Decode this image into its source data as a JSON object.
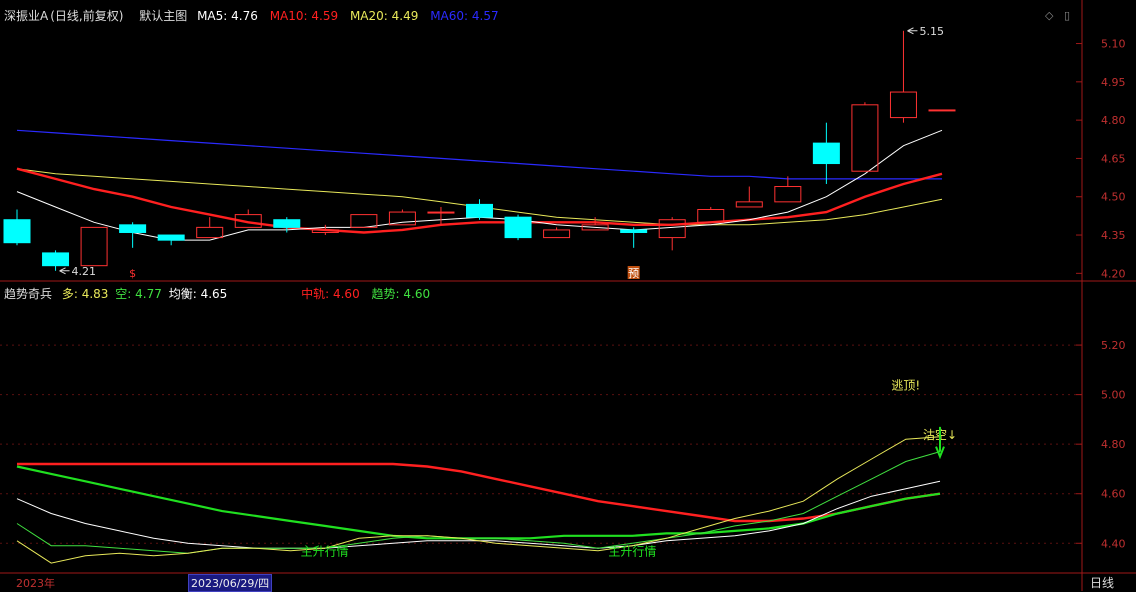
{
  "header": {
    "stock_name": "深振业A",
    "stock_mode": "(日线,前复权)",
    "template": "默认主图",
    "ma5_label": "MA5:",
    "ma5_value": "4.76",
    "ma10_label": "MA10:",
    "ma10_value": "4.59",
    "ma20_label": "MA20:",
    "ma20_value": "4.49",
    "ma60_label": "MA60:",
    "ma60_value": "4.57"
  },
  "sub_header": {
    "indicator": "趋势奇兵",
    "long_label": "多:",
    "long_value": "4.83",
    "short_label": "空:",
    "short_value": "4.77",
    "balance_label": "均衡:",
    "balance_value": "4.65",
    "mid_label": "中轨:",
    "mid_value": "4.60",
    "trend_label": "趋势:",
    "trend_value": "4.60"
  },
  "footer": {
    "year": "2023年",
    "cursor_date": "2023/06/29/四",
    "period": "日线"
  },
  "colors": {
    "up": "#ff3232",
    "down": "#00ffff",
    "ma5": "#ffffff",
    "ma10": "#ff2020",
    "ma20": "#e8e85a",
    "ma60": "#2a2aff",
    "green": "#20e020",
    "axis": "#a01818",
    "grid": "#5a1010"
  },
  "chart_data": [
    {
      "type": "candlestick",
      "name": "main",
      "ylim": [
        4.17,
        5.2
      ],
      "y_ticks": [
        "5.10",
        "4.95",
        "4.80",
        "4.65",
        "4.50",
        "4.35",
        "4.20"
      ],
      "candles": [
        {
          "open": 4.41,
          "high": 4.45,
          "low": 4.31,
          "close": 4.32
        },
        {
          "open": 4.28,
          "high": 4.29,
          "low": 4.21,
          "close": 4.23
        },
        {
          "open": 4.23,
          "high": 4.38,
          "low": 4.23,
          "close": 4.38
        },
        {
          "open": 4.39,
          "high": 4.4,
          "low": 4.3,
          "close": 4.36
        },
        {
          "open": 4.35,
          "high": 4.35,
          "low": 4.31,
          "close": 4.33
        },
        {
          "open": 4.34,
          "high": 4.42,
          "low": 4.34,
          "close": 4.38
        },
        {
          "open": 4.38,
          "high": 4.45,
          "low": 4.38,
          "close": 4.43
        },
        {
          "open": 4.41,
          "high": 4.42,
          "low": 4.36,
          "close": 4.38
        },
        {
          "open": 4.36,
          "high": 4.39,
          "low": 4.35,
          "close": 4.37
        },
        {
          "open": 4.38,
          "high": 4.43,
          "low": 4.38,
          "close": 4.43
        },
        {
          "open": 4.39,
          "high": 4.45,
          "low": 4.39,
          "close": 4.44
        },
        {
          "open": 4.44,
          "high": 4.46,
          "low": 4.39,
          "close": 4.44
        },
        {
          "open": 4.47,
          "high": 4.49,
          "low": 4.41,
          "close": 4.42
        },
        {
          "open": 4.42,
          "high": 4.43,
          "low": 4.33,
          "close": 4.34
        },
        {
          "open": 4.34,
          "high": 4.38,
          "low": 4.34,
          "close": 4.37
        },
        {
          "open": 4.37,
          "high": 4.42,
          "low": 4.37,
          "close": 4.39
        },
        {
          "open": 4.37,
          "high": 4.38,
          "low": 4.3,
          "close": 4.36
        },
        {
          "open": 4.34,
          "high": 4.42,
          "low": 4.29,
          "close": 4.41
        },
        {
          "open": 4.4,
          "high": 4.46,
          "low": 4.4,
          "close": 4.45
        },
        {
          "open": 4.46,
          "high": 4.54,
          "low": 4.46,
          "close": 4.48
        },
        {
          "open": 4.48,
          "high": 4.58,
          "low": 4.48,
          "close": 4.54
        },
        {
          "open": 4.71,
          "high": 4.79,
          "low": 4.55,
          "close": 4.63
        },
        {
          "open": 4.6,
          "high": 4.87,
          "low": 4.6,
          "close": 4.86
        },
        {
          "open": 4.81,
          "high": 5.15,
          "low": 4.79,
          "close": 4.91
        },
        {
          "open": 4.84,
          "high": 4.84,
          "low": 4.84,
          "close": 4.84
        }
      ],
      "ma5": [
        4.52,
        4.46,
        4.4,
        4.36,
        4.33,
        4.33,
        4.37,
        4.37,
        4.38,
        4.38,
        4.4,
        4.41,
        4.42,
        4.41,
        4.39,
        4.38,
        4.37,
        4.38,
        4.39,
        4.41,
        4.44,
        4.5,
        4.59,
        4.7,
        4.76
      ],
      "ma10": [
        4.61,
        4.57,
        4.53,
        4.5,
        4.46,
        4.43,
        4.4,
        4.38,
        4.37,
        4.36,
        4.37,
        4.39,
        4.4,
        4.4,
        4.4,
        4.4,
        4.39,
        4.39,
        4.4,
        4.41,
        4.42,
        4.44,
        4.5,
        4.55,
        4.59
      ],
      "ma20": [
        4.61,
        4.59,
        4.58,
        4.57,
        4.56,
        4.55,
        4.54,
        4.53,
        4.52,
        4.51,
        4.5,
        4.48,
        4.46,
        4.44,
        4.42,
        4.41,
        4.4,
        4.39,
        4.39,
        4.39,
        4.4,
        4.41,
        4.43,
        4.46,
        4.49
      ],
      "ma60": [
        4.76,
        4.75,
        4.74,
        4.73,
        4.72,
        4.71,
        4.7,
        4.69,
        4.68,
        4.67,
        4.66,
        4.65,
        4.64,
        4.63,
        4.62,
        4.61,
        4.6,
        4.59,
        4.58,
        4.58,
        4.57,
        4.57,
        4.57,
        4.57,
        4.57
      ],
      "annotations": [
        {
          "index": 1,
          "price": 4.21,
          "text": "4.21"
        },
        {
          "index": 23,
          "price": 5.15,
          "text": "5.15"
        }
      ],
      "markers": [
        {
          "index": 3,
          "text": "$"
        },
        {
          "index": 16,
          "text": "预"
        }
      ]
    },
    {
      "type": "line",
      "name": "trend",
      "ylim": [
        4.28,
        5.39
      ],
      "y_ticks": [
        "5.20",
        "5.00",
        "4.80",
        "4.60",
        "4.40"
      ],
      "series": [
        {
          "key": "mid",
          "color": "#ff2020",
          "width": 2.4,
          "values": [
            4.72,
            4.72,
            4.72,
            4.72,
            4.72,
            4.72,
            4.72,
            4.72,
            4.72,
            4.72,
            4.72,
            4.72,
            4.71,
            4.69,
            4.66,
            4.63,
            4.6,
            4.57,
            4.55,
            4.53,
            4.51,
            4.49,
            4.49,
            4.5,
            4.52,
            4.55,
            4.58,
            4.6
          ]
        },
        {
          "key": "trend",
          "color": "#20e020",
          "width": 2.2,
          "values": [
            4.71,
            4.68,
            4.65,
            4.62,
            4.59,
            4.56,
            4.53,
            4.51,
            4.49,
            4.47,
            4.45,
            4.43,
            4.42,
            4.42,
            4.42,
            4.42,
            4.43,
            4.43,
            4.43,
            4.44,
            4.44,
            4.45,
            4.46,
            4.48,
            4.52,
            4.55,
            4.58,
            4.6
          ]
        },
        {
          "key": "balance",
          "color": "#ffffff",
          "width": 1,
          "values": [
            4.58,
            4.52,
            4.48,
            4.45,
            4.42,
            4.4,
            4.39,
            4.38,
            4.38,
            4.38,
            4.39,
            4.4,
            4.41,
            4.41,
            4.41,
            4.4,
            4.39,
            4.38,
            4.39,
            4.41,
            4.42,
            4.43,
            4.45,
            4.48,
            4.54,
            4.59,
            4.62,
            4.65
          ]
        },
        {
          "key": "short",
          "color": "#40e040",
          "width": 1,
          "values": [
            4.48,
            4.39,
            4.39,
            4.38,
            4.37,
            4.36,
            4.38,
            4.38,
            4.38,
            4.38,
            4.4,
            4.42,
            4.43,
            4.42,
            4.42,
            4.41,
            4.4,
            4.38,
            4.4,
            4.42,
            4.44,
            4.47,
            4.49,
            4.52,
            4.59,
            4.66,
            4.73,
            4.77
          ]
        },
        {
          "key": "long",
          "color": "#e8e85a",
          "width": 1,
          "values": [
            4.41,
            4.32,
            4.35,
            4.36,
            4.35,
            4.36,
            4.38,
            4.38,
            4.37,
            4.38,
            4.42,
            4.43,
            4.43,
            4.42,
            4.4,
            4.39,
            4.38,
            4.37,
            4.39,
            4.42,
            4.46,
            4.5,
            4.53,
            4.57,
            4.66,
            4.74,
            4.82,
            4.83
          ]
        }
      ],
      "labels": [
        {
          "index": 9,
          "value": 4.35,
          "text": "主升行情",
          "color": "#20e020"
        },
        {
          "index": 18,
          "value": 4.35,
          "text": "主升行情",
          "color": "#20e020"
        },
        {
          "index": 26,
          "value": 5.02,
          "text": "逃顶!",
          "color": "#e8e85a"
        },
        {
          "index": 27,
          "value": 4.82,
          "text": "沽空↓",
          "color": "#e8e85a"
        }
      ]
    }
  ]
}
